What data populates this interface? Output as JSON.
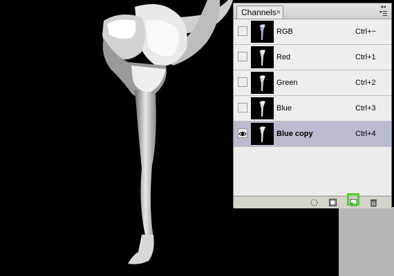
{
  "panel": {
    "tab_title": "Channels",
    "tab_close": "×",
    "collapse_glyph": "◂◂",
    "menu_icon": "panel-menu-icon",
    "channels": [
      {
        "name": "RGB",
        "shortcut": "Ctrl+~",
        "visible": false,
        "selected": false
      },
      {
        "name": "Red",
        "shortcut": "Ctrl+1",
        "visible": false,
        "selected": false
      },
      {
        "name": "Green",
        "shortcut": "Ctrl+2",
        "visible": false,
        "selected": false
      },
      {
        "name": "Blue",
        "shortcut": "Ctrl+3",
        "visible": false,
        "selected": false
      },
      {
        "name": "Blue copy",
        "shortcut": "Ctrl+4",
        "visible": true,
        "selected": true
      }
    ],
    "footer_icons": [
      "load-selection-icon",
      "save-selection-icon",
      "new-channel-icon",
      "delete-channel-icon"
    ]
  },
  "colors": {
    "selected_row": "#b9bcce",
    "highlight": "#4ad02e",
    "canvas": "#000000"
  }
}
